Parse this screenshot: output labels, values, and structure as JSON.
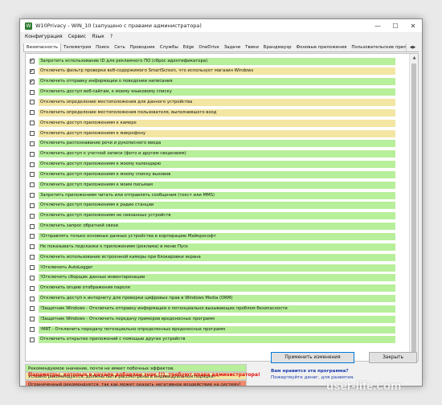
{
  "window": {
    "title": "W10Privacy - WIN_10   (запущено с правами администратора)",
    "icon": "w10privacy-app-icon",
    "controls": [
      "—",
      "☐",
      "✕"
    ]
  },
  "menu": [
    "Конфигурация",
    "Сервис",
    "Язык",
    "?"
  ],
  "tabs": [
    "Безопасность",
    "Телеметрия",
    "Поиск",
    "Сеть",
    "Проводник",
    "Службы",
    "Edge",
    "OneDrive",
    "Задачи",
    "Твики",
    "Брандмауэр",
    "Фоновые приложения",
    "Пользовательские прилож"
  ],
  "tab_scroll": [
    "◀",
    "▶"
  ],
  "colors": {
    "green": "#b7ef9a",
    "yellow": "#f3e6a3",
    "red": "#f08a6c",
    "accent": "#0078d7",
    "red_text": "#dd1111",
    "promo_blue": "#1a3bb0"
  },
  "settings": [
    {
      "label": "Запретить использование ID для рекламного ПО (сброс идентификатора)",
      "checked": true,
      "color": "green"
    },
    {
      "label": "Отключить фильтр проверки веб-содержимого SmartScreen, что использует магазин Windows",
      "checked": true,
      "color": "yellow"
    },
    {
      "label": "Отключить отправку информации о поведении написания",
      "checked": true,
      "color": "green"
    },
    {
      "label": "Отключить доступ веб-сайтам, к моему языковому списку",
      "checked": false,
      "color": "green"
    },
    {
      "label": "Отключить определение местоположения для данного устройства",
      "checked": false,
      "color": "yellow"
    },
    {
      "label": "Отключить определение местоположения пользователя, выполнившего вход",
      "checked": false,
      "color": "yellow"
    },
    {
      "label": "Отключить доступ приложениям к камере",
      "checked": false,
      "color": "yellow"
    },
    {
      "label": "Отключить доступ приложениям к микрофону",
      "checked": false,
      "color": "yellow"
    },
    {
      "label": "Отключить распознавание речи и рукописного ввода",
      "checked": false,
      "color": "green"
    },
    {
      "label": "Отключить доступ к учетной записи (фото и другим сведениям)",
      "checked": false,
      "color": "green"
    },
    {
      "label": "Отключить доступ приложениям к моему календарю",
      "checked": false,
      "color": "green"
    },
    {
      "label": "Отключить доступ приложениям к моему списку вызовов",
      "checked": false,
      "color": "green"
    },
    {
      "label": "Отключить доступ приложениям к моим письмам",
      "checked": false,
      "color": "green"
    },
    {
      "label": "Запретить приложениям читать или отправлять сообщения (текст или MMS)",
      "checked": false,
      "color": "green"
    },
    {
      "label": "Отключить доступ приложениям к радио станции",
      "checked": false,
      "color": "green"
    },
    {
      "label": "Отключить доступ приложениям не связанных устройств",
      "checked": false,
      "color": "green"
    },
    {
      "label": "Отключить запрос обратной связи",
      "checked": false,
      "color": "green"
    },
    {
      "label": "!Отправлять только основные данные устройства в корпорацию Майкрософт",
      "checked": false,
      "color": "green"
    },
    {
      "label": "Не показывать подсказки к приложениям (реклама) в меню Пуск",
      "checked": false,
      "color": "green"
    },
    {
      "label": "Отключить использование встроенной камеры при блокировки экрана",
      "checked": false,
      "color": "green"
    },
    {
      "label": "!Отключить AutoLogger",
      "checked": false,
      "color": "green"
    },
    {
      "label": "!Отключить сборщик данных инвентаризации",
      "checked": false,
      "color": "green"
    },
    {
      "label": "Отключить опцию отображения пароля",
      "checked": false,
      "color": "green"
    },
    {
      "label": "Отключить доступ к интернету для проверки цифровых прав в Windows Media (DRM)",
      "checked": false,
      "color": "green"
    },
    {
      "label": "!Защитник Windows - Отключить отправку информации о потенциально вызывающих проблем безопасности",
      "checked": false,
      "color": "green"
    },
    {
      "label": "!Защитник Windows - Отключить передачу примеров вредоносных программ",
      "checked": false,
      "color": "green"
    },
    {
      "label": "!MRT - Отключить передачу потенциально определенных вредоносных программ",
      "checked": false,
      "color": "green"
    },
    {
      "label": "Отключить открытие приложений с помощью других устройств",
      "checked": false,
      "color": "green"
    }
  ],
  "legend": {
    "green": "Рекомендуемое значение, почти не имеет побочных эффектов.",
    "yellow": "Условно рекомендуется, должны быть рассмотрены в индивидуальном порядке!",
    "red": "Ограниченный рекомендуется, так как может оказать негативное воздействие на систему!"
  },
  "buttons": {
    "apply": "Применить изменения",
    "close": "Закрыть"
  },
  "notice": "Параметры, которые в начале добавлен знак (!), требуют права администратора!",
  "promo": {
    "line1": "Вам нравится эта программа?",
    "line2": "Пожертвуйте денег, для развития."
  },
  "watermark": "user-life.com"
}
